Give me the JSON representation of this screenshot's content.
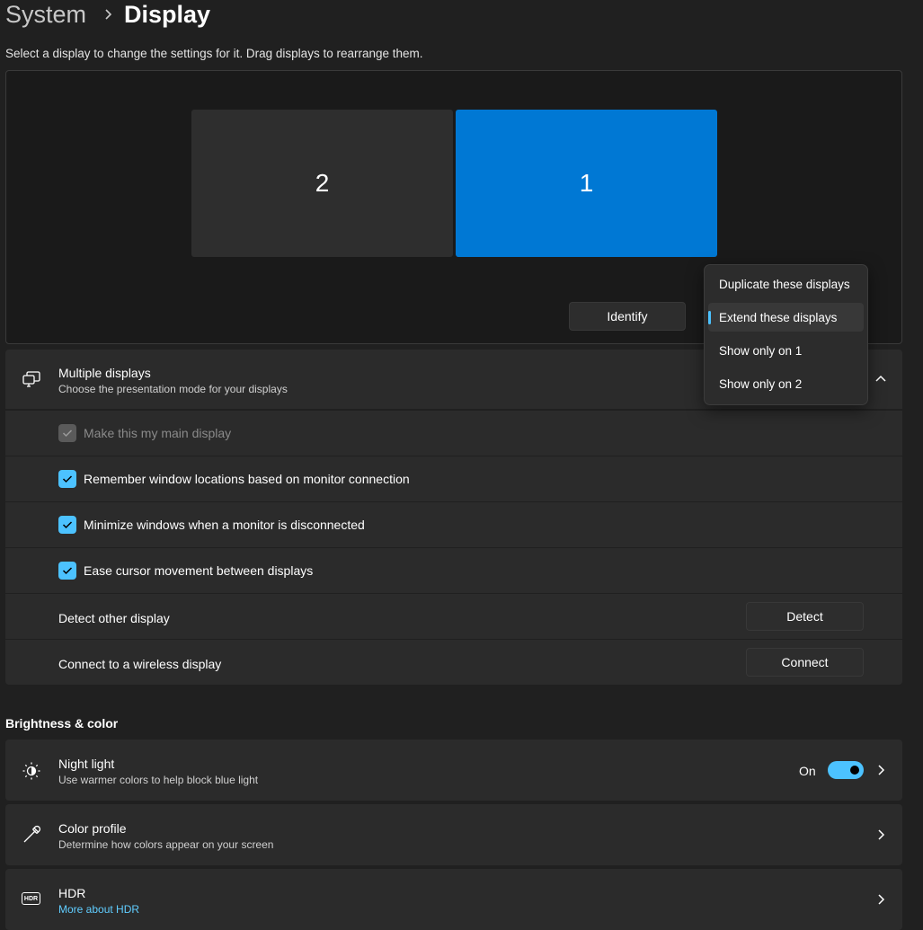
{
  "breadcrumb": {
    "parent": "System",
    "current": "Display"
  },
  "instruction": "Select a display to change the settings for it. Drag displays to rearrange them.",
  "arrangement": {
    "monitors": [
      {
        "label": "2",
        "selected": false
      },
      {
        "label": "1",
        "selected": true
      }
    ],
    "identify_label": "Identify",
    "accent_color": "#0078d4"
  },
  "dropdown": {
    "items": [
      {
        "label": "Duplicate these displays",
        "selected": false
      },
      {
        "label": "Extend these displays",
        "selected": true
      },
      {
        "label": "Show only on 1",
        "selected": false
      },
      {
        "label": "Show only on 2",
        "selected": false
      }
    ]
  },
  "multiple_displays": {
    "title": "Multiple displays",
    "subtitle": "Choose the presentation mode for your displays",
    "options": [
      {
        "label": "Make this my main display",
        "checked": true,
        "disabled": true
      },
      {
        "label": "Remember window locations based on monitor connection",
        "checked": true,
        "disabled": false
      },
      {
        "label": "Minimize windows when a monitor is disconnected",
        "checked": true,
        "disabled": false
      },
      {
        "label": "Ease cursor movement between displays",
        "checked": true,
        "disabled": false
      }
    ],
    "detect": {
      "label": "Detect other display",
      "button": "Detect"
    },
    "connect": {
      "label": "Connect to a wireless display",
      "button": "Connect"
    }
  },
  "brightness_color": {
    "heading": "Brightness & color",
    "night_light": {
      "title": "Night light",
      "subtitle": "Use warmer colors to help block blue light",
      "state": "On",
      "enabled": true
    },
    "color_profile": {
      "title": "Color profile",
      "subtitle": "Determine how colors appear on your screen"
    },
    "hdr": {
      "title": "HDR",
      "link": "More about HDR",
      "icon_text": "HDR"
    }
  }
}
